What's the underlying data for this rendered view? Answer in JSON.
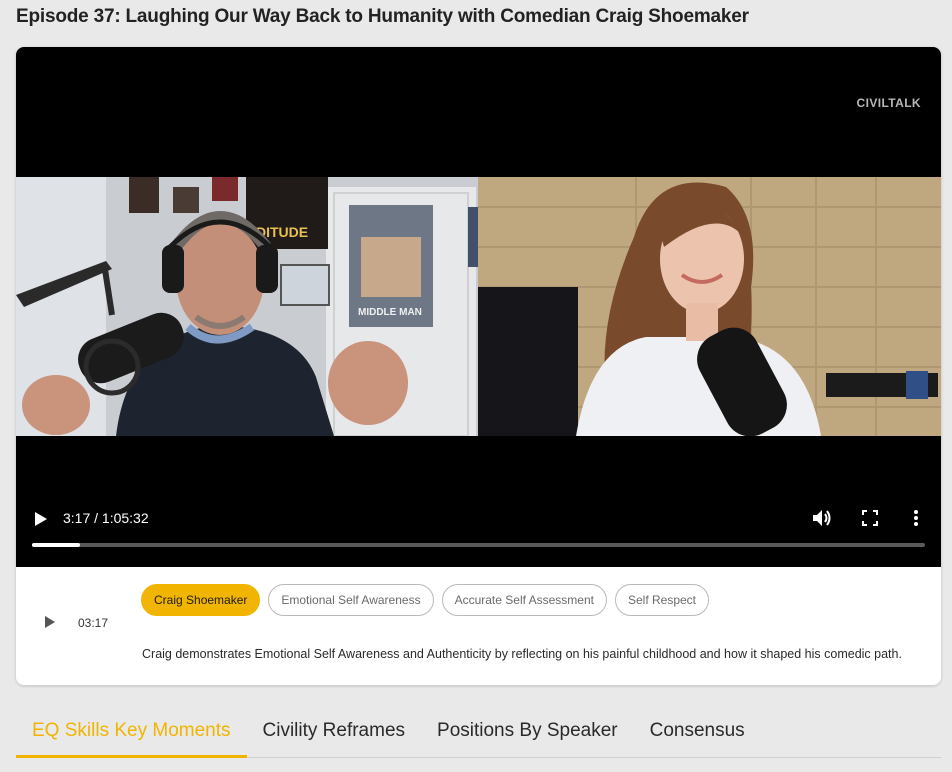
{
  "page": {
    "title": "Episode 37: Laughing Our Way Back to Humanity with Comedian Craig Shoemaker"
  },
  "video": {
    "watermark": "CIVILTALK",
    "time_display": "3:17 / 1:05:32",
    "progress_fraction": 0.054,
    "icons": {
      "play": "play-icon",
      "volume": "volume-icon",
      "fullscreen": "fullscreen-icon",
      "more": "more-options-icon"
    }
  },
  "moment": {
    "timestamp": "03:17",
    "tags": [
      {
        "label": "Craig Shoemaker",
        "active": true
      },
      {
        "label": "Emotional Self Awareness",
        "active": false
      },
      {
        "label": "Accurate Self Assessment",
        "active": false
      },
      {
        "label": "Self Respect",
        "active": false
      }
    ],
    "description": "Craig demonstrates Emotional Self Awareness and Authenticity by reflecting on his painful childhood and how it shaped his comedic path."
  },
  "tabs": [
    {
      "label": "EQ Skills Key Moments",
      "active": true
    },
    {
      "label": "Civility Reframes",
      "active": false
    },
    {
      "label": "Positions By Speaker",
      "active": false
    },
    {
      "label": "Consensus",
      "active": false
    }
  ],
  "colors": {
    "accent": "#f1b400",
    "video_bg": "#000000",
    "page_bg": "#e9e9e9"
  }
}
